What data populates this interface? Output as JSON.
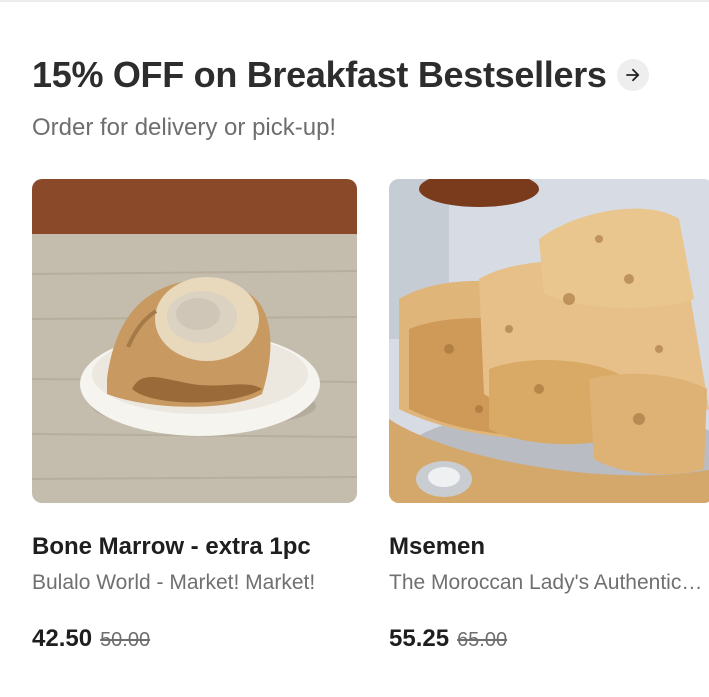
{
  "section": {
    "title": "15% OFF on Breakfast Bestsellers",
    "subtitle": "Order for delivery or pick-up!",
    "arrow_icon": "arrow-right-icon"
  },
  "items": [
    {
      "name": "Bone Marrow - extra 1pc",
      "store": "Bulalo World - Market! Market!",
      "price": "42.50",
      "original_price": "50.00",
      "image": "bone-marrow-photo"
    },
    {
      "name": "Msemen",
      "store": "The Moroccan Lady's Authentic Kitchen",
      "price": "55.25",
      "original_price": "65.00",
      "image": "msemen-photo"
    }
  ],
  "colors": {
    "title_text": "#2d2d2d",
    "muted_text": "#6e6e6e",
    "arrow_bg": "#eeeeee"
  }
}
